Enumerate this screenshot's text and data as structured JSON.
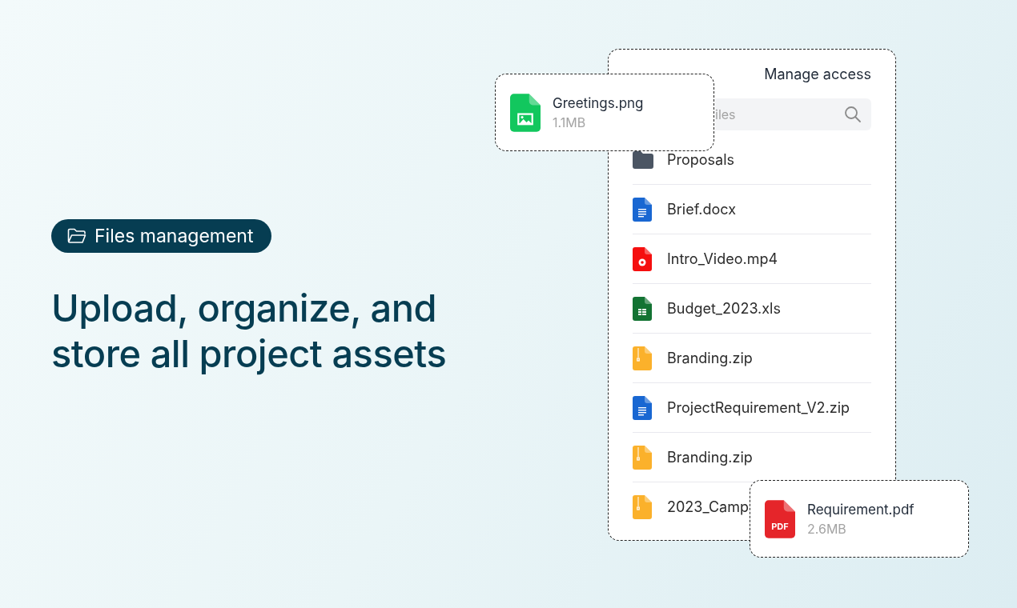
{
  "hero": {
    "badge": "Files management",
    "heading": "Upload, organize, and store all project assets"
  },
  "panel": {
    "title": "Manage access",
    "search": {
      "placeholder": "iles"
    },
    "files": [
      {
        "name": "Proposals",
        "kind": "folder"
      },
      {
        "name": "Brief.docx",
        "kind": "doc"
      },
      {
        "name": "Intro_Video.mp4",
        "kind": "video"
      },
      {
        "name": "Budget_2023.xls",
        "kind": "sheet"
      },
      {
        "name": "Branding.zip",
        "kind": "zip"
      },
      {
        "name": "ProjectRequirement_V2.zip",
        "kind": "doc"
      },
      {
        "name": "Branding.zip",
        "kind": "zip"
      },
      {
        "name": "2023_Camp",
        "kind": "zip"
      }
    ]
  },
  "floating_cards": [
    {
      "name": "Greetings.png",
      "size": "1.1MB",
      "kind": "image"
    },
    {
      "name": "Requirement.pdf",
      "size": "2.6MB",
      "kind": "pdf",
      "icon_label": "PDF"
    }
  ]
}
